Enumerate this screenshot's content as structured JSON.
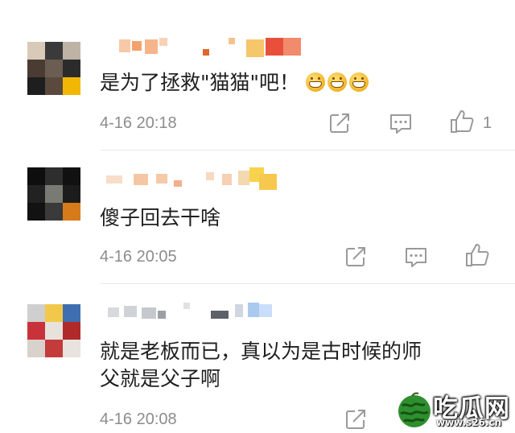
{
  "comments": [
    {
      "text": "是为了拯救\"猫猫\"吧！",
      "emoji_names": [
        "grin-emoji",
        "grin-emoji",
        "grin-emoji"
      ],
      "time": "4-16 20:18",
      "like_count": "1"
    },
    {
      "text": "傻子回去干啥",
      "time": "4-16 20:05",
      "like_count": ""
    },
    {
      "text_line1": "就是老板而已，真以为是古时候的师",
      "text_line2": "父就是父子啊",
      "time": "4-16 20:08",
      "like_count": ""
    }
  ],
  "icons": [
    "share-icon",
    "reply-icon",
    "like-icon"
  ],
  "colors": {
    "text": "#1f1f1f",
    "meta": "#8c8c8c",
    "icon": "#9a9a9a",
    "divider": "#e9e9e9"
  },
  "watermark": {
    "title": "吃瓜网",
    "url": "www.s26.cn"
  }
}
